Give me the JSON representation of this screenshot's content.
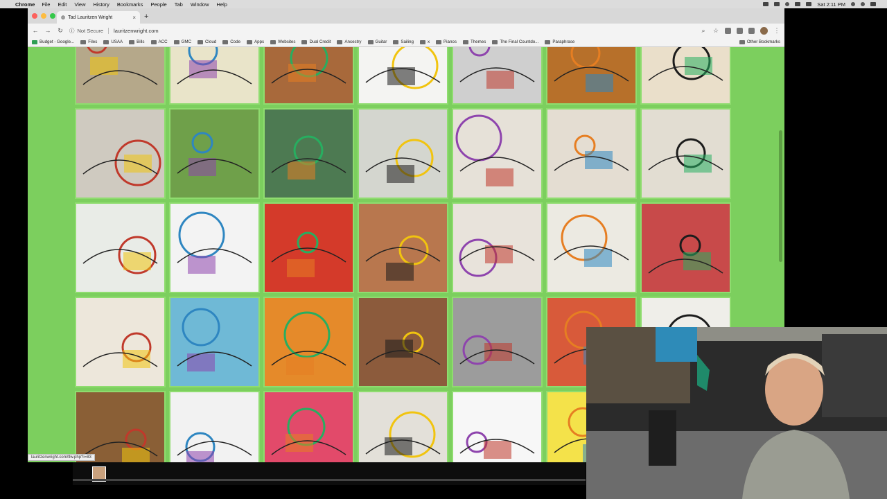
{
  "menubar": {
    "app": "Chrome",
    "items": [
      "File",
      "Edit",
      "View",
      "History",
      "Bookmarks",
      "People",
      "Tab",
      "Window",
      "Help"
    ],
    "clock": "Sat 2:11 PM"
  },
  "tab": {
    "title": "Tad Lauritzen Wright"
  },
  "toolbar": {
    "security": "Not Secure",
    "url": "lauritzenwright.com"
  },
  "bookmarks": {
    "items": [
      "Budget - Google...",
      "Files",
      "USAA",
      "Bills",
      "ACC",
      "GMC",
      "Cloud",
      "Code",
      "Apps",
      "Websites",
      "Dual Credit",
      "Ancestry",
      "Guitar",
      "Sailing",
      "x",
      "Pianos",
      "Themes",
      "The Final Countdo...",
      "Paraphrase"
    ],
    "other": "Other Bookmarks"
  },
  "status": {
    "link": "lauritzenwright.com/tlw.php?i=83"
  },
  "colors": {
    "page_bg": "#7ccf5e",
    "tile_border": "#8fdc6f"
  },
  "gallery": [
    {
      "bg": "#b5a88a"
    },
    {
      "bg": "#e9e4c9"
    },
    {
      "bg": "#a8693b"
    },
    {
      "bg": "#f4f4f2"
    },
    {
      "bg": "#cfcfcf"
    },
    {
      "bg": "#b7702a"
    },
    {
      "bg": "#eadfca"
    },
    {
      "bg": "#cfcac0"
    },
    {
      "bg": "#6fa04a"
    },
    {
      "bg": "#4d7a52"
    },
    {
      "bg": "#d4d6cf"
    },
    {
      "bg": "#e6e1d8"
    },
    {
      "bg": "#e4ddd2"
    },
    {
      "bg": "#e2ddd2"
    },
    {
      "bg": "#e9ece7"
    },
    {
      "bg": "#f3f3f3"
    },
    {
      "bg": "#d43a2a"
    },
    {
      "bg": "#b8774e"
    },
    {
      "bg": "#e8e3db"
    },
    {
      "bg": "#eceae2"
    },
    {
      "bg": "#c84a4a"
    },
    {
      "bg": "#ede7db"
    },
    {
      "bg": "#6fb9d6"
    },
    {
      "bg": "#e58a2a"
    },
    {
      "bg": "#8c5b3c"
    },
    {
      "bg": "#9c9c9c"
    },
    {
      "bg": "#d85a3a"
    },
    {
      "bg": "#efeee9"
    },
    {
      "bg": "#8a5f36"
    },
    {
      "bg": "#f2f2f2"
    },
    {
      "bg": "#e24a6a"
    },
    {
      "bg": "#e3e0d9"
    },
    {
      "bg": "#f7f7f7"
    },
    {
      "bg": "#f4e24a"
    },
    {
      "bg": "#f4e24a"
    }
  ]
}
